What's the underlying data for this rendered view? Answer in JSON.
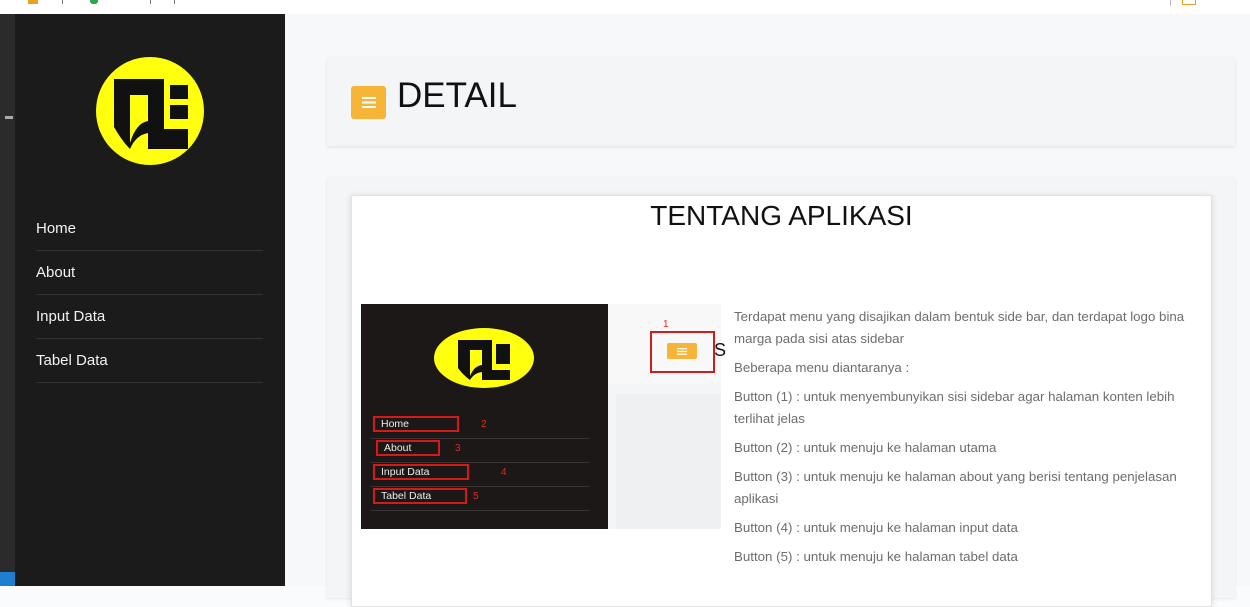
{
  "sidebar": {
    "items": [
      {
        "label": "Home"
      },
      {
        "label": "About"
      },
      {
        "label": "Input Data"
      },
      {
        "label": "Tabel Data"
      }
    ]
  },
  "header": {
    "title": "DETAIL"
  },
  "content": {
    "title": "TENTANG APLIKASI",
    "screenshot": {
      "items": [
        {
          "label": "Home",
          "number": "2"
        },
        {
          "label": "About",
          "number": "3"
        },
        {
          "label": "Input Data",
          "number": "4"
        },
        {
          "label": "Tabel Data",
          "number": "5"
        }
      ],
      "toggle_number": "1",
      "cropped_letter": "S"
    },
    "paragraphs": [
      "Terdapat menu yang disajikan dalam bentuk side bar, dan terdapat logo bina marga pada sisi atas sidebar",
      "Beberapa menu diantaranya :",
      "Button (1) : untuk menyembunyikan sisi sidebar agar halaman konten lebih terlihat jelas",
      "Button (2) : untuk menuju ke halaman utama",
      "Button (3) : untuk menuju ke halaman about yang berisi tentang penjelasan aplikasi",
      "Button (4) : untuk menuju ke halaman input data",
      "Button (5) : untuk menuju ke halaman tabel data"
    ]
  },
  "colors": {
    "sidebar_bg": "#1b1b1b",
    "accent": "#f6b537",
    "logo_yellow": "#ffff0e",
    "annotation_red": "#d41a1a"
  }
}
